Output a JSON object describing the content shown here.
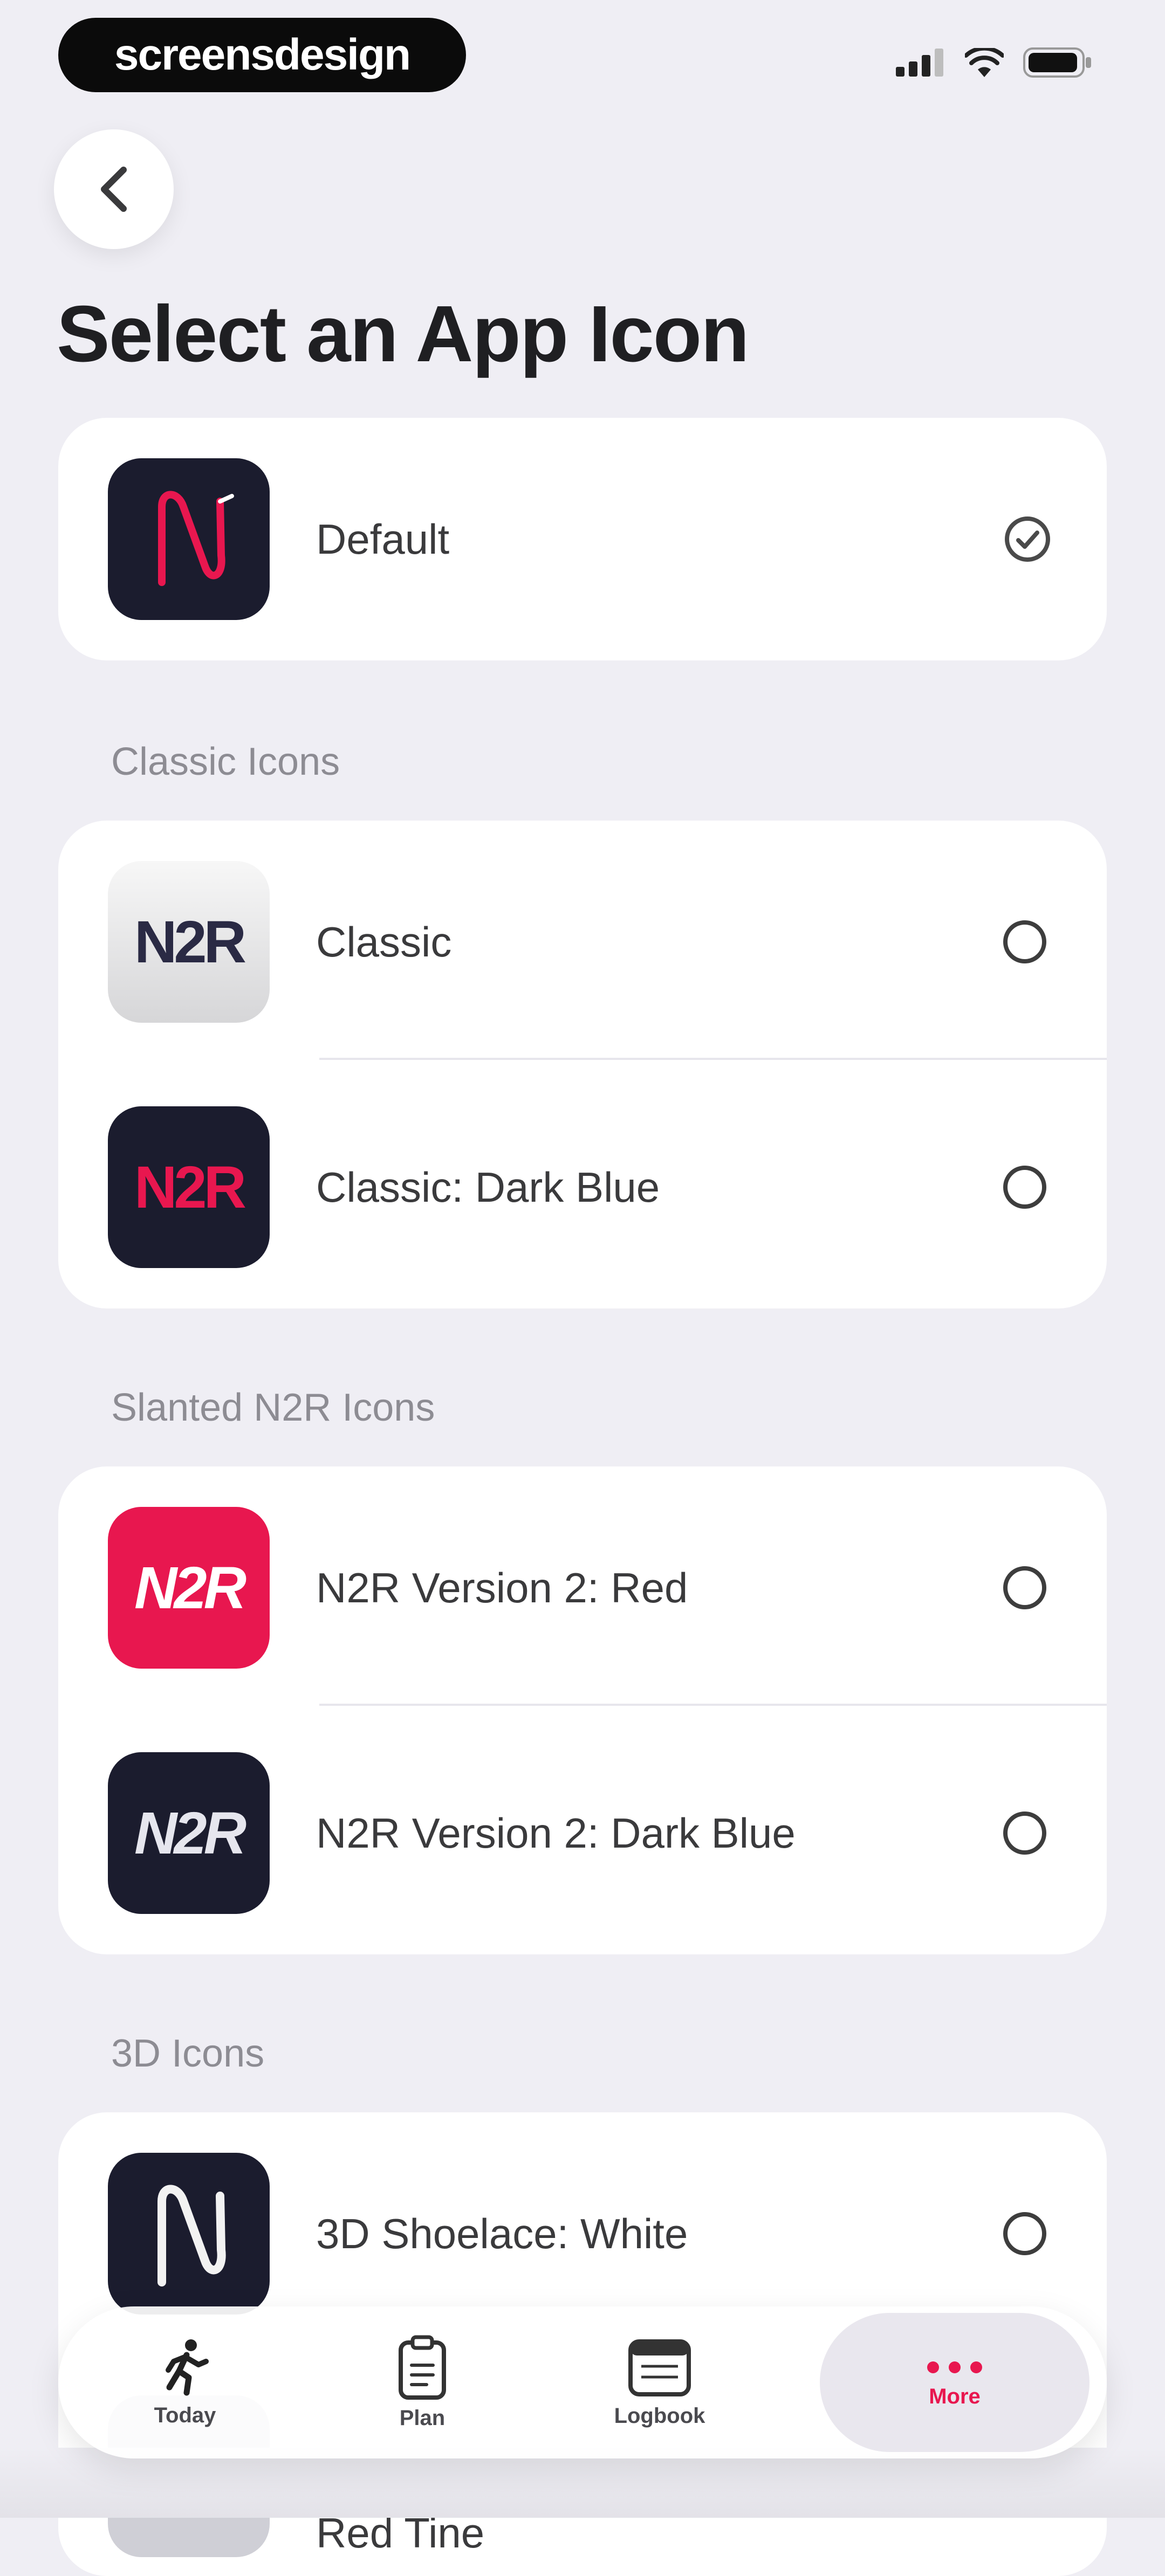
{
  "status_bar": {
    "brand": "screensdesign"
  },
  "header": {
    "title": "Select an App Icon"
  },
  "default_group": {
    "items": [
      {
        "label": "Default",
        "selected": true
      }
    ]
  },
  "sections": [
    {
      "title": "Classic Icons",
      "items": [
        {
          "label": "Classic",
          "selected": false
        },
        {
          "label": "Classic: Dark Blue",
          "selected": false
        }
      ]
    },
    {
      "title": "Slanted N2R Icons",
      "items": [
        {
          "label": "N2R Version 2: Red",
          "selected": false
        },
        {
          "label": "N2R Version 2: Dark Blue",
          "selected": false
        }
      ]
    },
    {
      "title": "3D Icons",
      "items": [
        {
          "label": "3D Shoelace: White",
          "selected": false
        },
        {
          "label": "Red Tine",
          "selected": false
        }
      ]
    }
  ],
  "icon_text": {
    "n2r": "N2R"
  },
  "tab_bar": {
    "items": [
      {
        "label": "Today",
        "icon": "runner-icon"
      },
      {
        "label": "Plan",
        "icon": "clipboard-icon"
      },
      {
        "label": "Logbook",
        "icon": "calendar-icon"
      },
      {
        "label": "More",
        "icon": "ellipsis-icon",
        "active": true
      }
    ]
  },
  "colors": {
    "accent": "#e8174f",
    "dark_navy": "#1b1c2e",
    "background": "#efeef4"
  }
}
